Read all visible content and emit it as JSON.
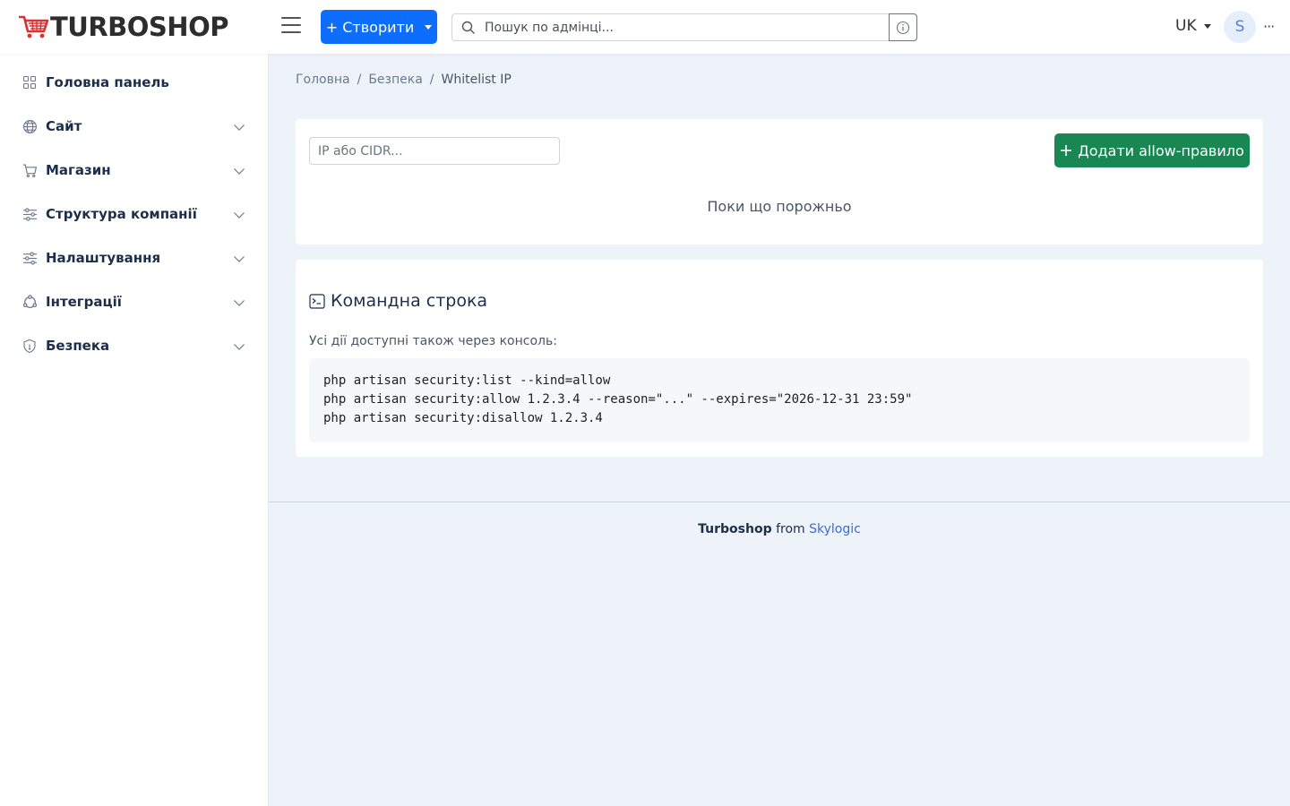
{
  "header": {
    "logo_text": "TURBOSHOP",
    "create_label": "+ Створити",
    "search_placeholder": "Пошук по адмінці...",
    "lang": "UK",
    "avatar_letter": "S",
    "more_label": "···"
  },
  "sidebar": {
    "items": [
      {
        "label": "Головна панель",
        "icon": "dashboard-icon"
      },
      {
        "label": "Сайт",
        "icon": "globe-icon"
      },
      {
        "label": "Магазин",
        "icon": "cart-icon"
      },
      {
        "label": "Структура компанії",
        "icon": "sliders-icon"
      },
      {
        "label": "Налаштування",
        "icon": "settings-sliders-icon"
      },
      {
        "label": "Інтеграції",
        "icon": "integrations-icon"
      },
      {
        "label": "Безпека",
        "icon": "shield-icon"
      }
    ]
  },
  "breadcrumb": {
    "home": "Головна",
    "sep": "/",
    "section": "Безпека",
    "current": "Whitelist IP"
  },
  "whitelist": {
    "ip_placeholder": "IP або CIDR...",
    "add_label": "Додати allow-правило",
    "empty_text": "Поки що порожньо"
  },
  "console": {
    "title": "Командна строка",
    "description": "Усі дії доступні також через консоль:",
    "lines": [
      "php artisan security:list --kind=allow",
      "php artisan security:allow 1.2.3.4 --reason=\"...\" --expires=\"2026-12-31 23:59\"",
      "php artisan security:disallow 1.2.3.4"
    ]
  },
  "footer": {
    "brand": "Turboshop",
    "from": " from ",
    "company": "Skylogic"
  },
  "colors": {
    "primary": "#0d6efd",
    "success": "#198754",
    "logo_red": "#e03131",
    "nav_text": "#1d2e4a",
    "background": "#eef2f9"
  }
}
